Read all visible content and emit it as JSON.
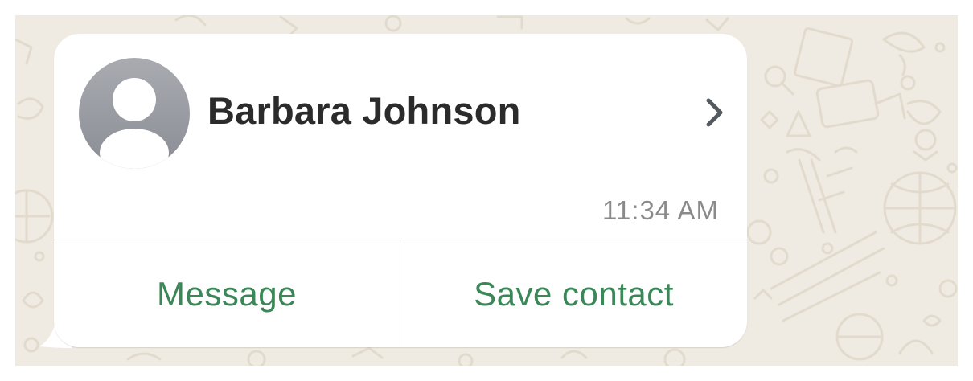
{
  "contact_card": {
    "name": "Barbara Johnson",
    "time": "11:34 AM",
    "avatar_icon": "person-silhouette-icon",
    "chevron_icon": "chevron-right-icon"
  },
  "actions": {
    "message_label": "Message",
    "save_contact_label": "Save contact"
  },
  "colors": {
    "chat_background": "#efeae2",
    "bubble": "#ffffff",
    "action_text": "#3a8757",
    "name_text": "#2b2b2b",
    "time_text": "#8a8a8a",
    "avatar_gradient_top": "#a9abb1",
    "avatar_gradient_bottom": "#8a8d94"
  }
}
